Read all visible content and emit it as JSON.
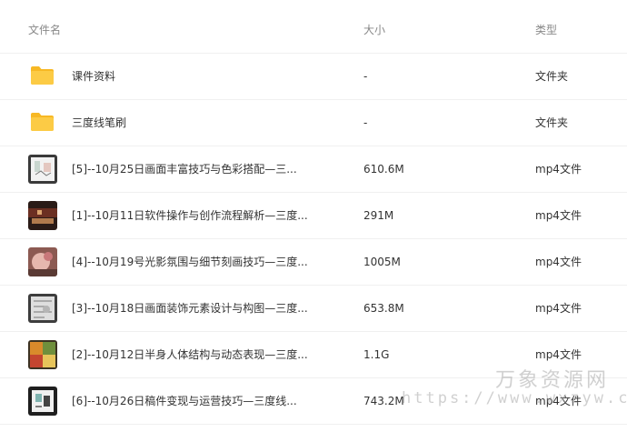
{
  "columns": {
    "name": "文件名",
    "size": "大小",
    "type": "类型"
  },
  "rows": [
    {
      "name": "课件资料",
      "size": "-",
      "type": "文件夹",
      "icon": "folder-icon"
    },
    {
      "name": "三度线笔刷",
      "size": "-",
      "type": "文件夹",
      "icon": "folder-icon"
    },
    {
      "name": "[5]--10月25日画面丰富技巧与色彩搭配—三...",
      "size": "610.6M",
      "type": "mp4文件",
      "icon": "video-thumbnail"
    },
    {
      "name": "[1]--10月11日软件操作与创作流程解析—三度...",
      "size": "291M",
      "type": "mp4文件",
      "icon": "video-thumbnail"
    },
    {
      "name": "[4]--10月19号光影氛围与细节刻画技巧—三度...",
      "size": "1005M",
      "type": "mp4文件",
      "icon": "video-thumbnail"
    },
    {
      "name": "[3]--10月18日画面装饰元素设计与构图—三度...",
      "size": "653.8M",
      "type": "mp4文件",
      "icon": "video-thumbnail"
    },
    {
      "name": "[2]--10月12日半身人体结构与动态表现—三度...",
      "size": "1.1G",
      "type": "mp4文件",
      "icon": "video-thumbnail"
    },
    {
      "name": "[6]--10月26日稿件变现与运营技巧—三度线...",
      "size": "743.2M",
      "type": "mp4文件",
      "icon": "video-thumbnail"
    }
  ],
  "watermark": {
    "title": "万象资源网",
    "url": "https://www.wxzyw.cn"
  },
  "colors": {
    "folder": "#F9C43A",
    "text": "#333333",
    "header_text": "#888888",
    "divider": "#F0F0F0"
  }
}
